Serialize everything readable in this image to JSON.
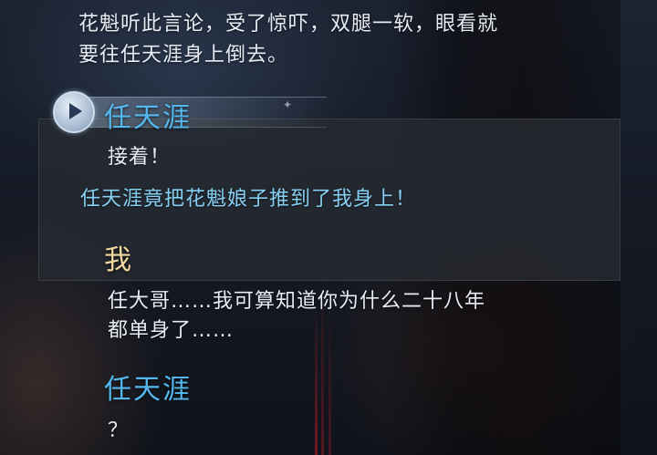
{
  "narration": {
    "line1": "花魁听此言论，受了惊吓，双腿一软，眼看就",
    "line2": "要往任天涯身上倒去。"
  },
  "dialogue1": {
    "speaker": "任天涯",
    "text": "接着！",
    "narration": "任天涯竟把花魁娘子推到了我身上！"
  },
  "dialogue2": {
    "speaker": "我",
    "line1": "任大哥……我可算知道你为什么二十八年",
    "line2": "都单身了……"
  },
  "dialogue3": {
    "speaker": "任天涯",
    "text": "？"
  },
  "colors": {
    "speaker_blue": "#54b8ee",
    "speaker_gold": "#f1d9a0",
    "narration_blue": "#86d0f4",
    "text": "#e8edf5"
  },
  "icons": {
    "voice_replay": "play-icon",
    "banner_ornament": "star-icon"
  }
}
